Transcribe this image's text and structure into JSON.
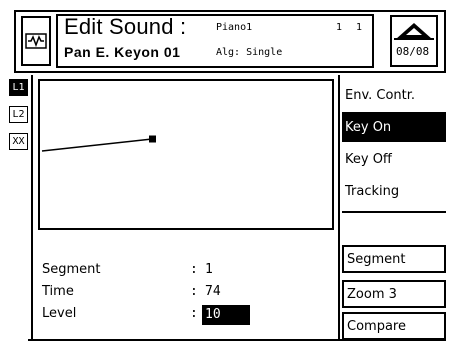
{
  "header": {
    "title": "Edit Sound :",
    "subtitle": "Pan E. Keyon 01",
    "program": "Piano1",
    "channel_a": "1",
    "channel_b": "1",
    "algorithm": "Alg: Single",
    "page": "08/08"
  },
  "layer_tabs": [
    {
      "label": "L1",
      "selected": true
    },
    {
      "label": "L2",
      "selected": false
    },
    {
      "label": "XX",
      "selected": false
    }
  ],
  "envelope": {
    "start_level": 0.0,
    "end_level": 0.1
  },
  "params": [
    {
      "label": "Segment",
      "value": "1"
    },
    {
      "label": "Time",
      "value": "74"
    },
    {
      "label": "Level",
      "value": "10"
    }
  ],
  "right_menu": {
    "items": [
      {
        "label": "Env. Contr.",
        "selected": false
      },
      {
        "label": "Key On",
        "selected": true
      },
      {
        "label": "Key Off",
        "selected": false
      },
      {
        "label": "Tracking",
        "selected": false
      }
    ],
    "buttons": [
      {
        "label": "Segment"
      },
      {
        "label": "Zoom 3"
      },
      {
        "label": "Compare"
      }
    ]
  }
}
